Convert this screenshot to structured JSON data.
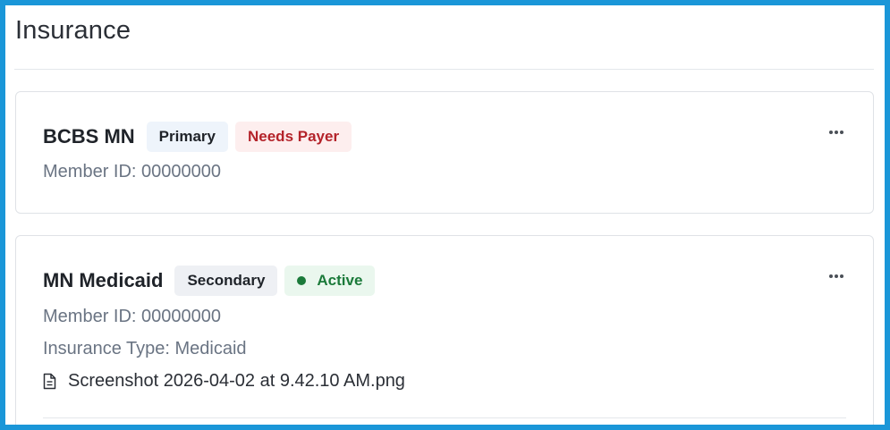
{
  "page": {
    "title": "Insurance"
  },
  "cards": [
    {
      "plan": "BCBS MN",
      "badges": [
        "Primary",
        "Needs Payer"
      ],
      "member_id": "Member ID: 00000000"
    },
    {
      "plan": "MN Medicaid",
      "badges": [
        "Secondary",
        "Active"
      ],
      "member_id": "Member ID: 00000000",
      "insurance_type": "Insurance Type: Medicaid",
      "file": "Screenshot 2026-04-02 at 9.42.10 AM.png"
    }
  ],
  "icons": {
    "more": "more-horizontal-icon",
    "file": "file-text-icon",
    "status": "status-dot-icon"
  },
  "colors": {
    "frame": "#1a96d8",
    "needs_payer_text": "#b4232a",
    "needs_payer_bg": "#fdeeee",
    "active_text": "#1b7a3a",
    "active_bg": "#eaf7ee"
  }
}
